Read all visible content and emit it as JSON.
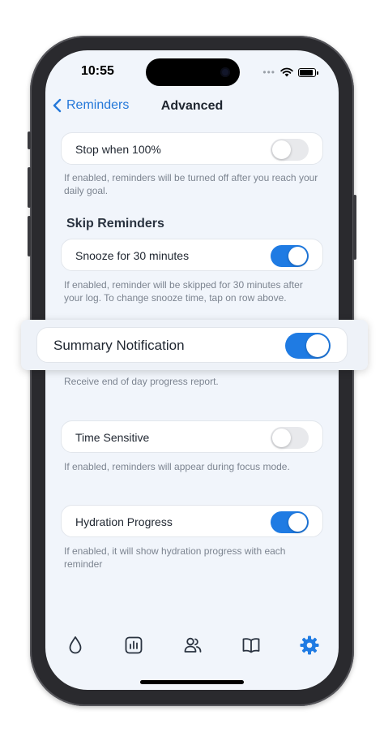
{
  "status_bar": {
    "time": "10:55",
    "dots": "•••"
  },
  "nav": {
    "back_label": "Reminders",
    "title": "Advanced"
  },
  "settings": {
    "stop_when_100": {
      "label": "Stop when 100%",
      "enabled": false,
      "hint": "If enabled, reminders will be turned off after you reach your daily goal."
    },
    "section_skip": "Skip Reminders",
    "snooze": {
      "label": "Snooze for 30 minutes",
      "enabled": true,
      "hint": "If enabled, reminder will be skipped for 30 minutes after your log. To change snooze time, tap on row above."
    },
    "summary_notification": {
      "label": "Summary Notification",
      "enabled": true,
      "hint": "Receive end of day progress report."
    },
    "time_sensitive": {
      "label": "Time Sensitive",
      "enabled": false,
      "hint": "If enabled, reminders will appear during focus mode."
    },
    "hydration_progress": {
      "label": "Hydration Progress",
      "enabled": true,
      "hint": "If enabled, it will show hydration progress with each reminder"
    }
  },
  "tabbar": {
    "items": [
      {
        "icon": "water-drop-icon",
        "active": false
      },
      {
        "icon": "chart-icon",
        "active": false
      },
      {
        "icon": "people-icon",
        "active": false
      },
      {
        "icon": "book-icon",
        "active": false
      },
      {
        "icon": "gear-icon",
        "active": true
      }
    ]
  },
  "colors": {
    "accent": "#1f7be3",
    "toggle_off": "#e8e9ec",
    "background": "#f1f5fb"
  }
}
